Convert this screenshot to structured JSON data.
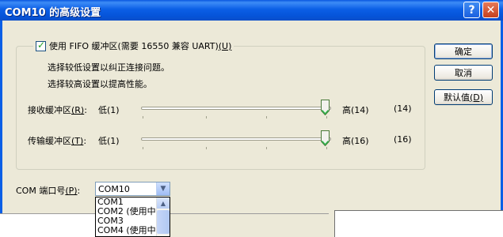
{
  "window": {
    "title": "COM10 的高级设置"
  },
  "titlebar_buttons": {
    "help": "?",
    "close": "✕"
  },
  "fifo": {
    "checkbox_label": "使用 FIFO 缓冲区(需要 16550 兼容 UART)",
    "checkbox_hotkey": "(U)",
    "checked": true,
    "hint_low": "选择较低设置以纠正连接问题。",
    "hint_high": "选择较高设置以提高性能。"
  },
  "receive": {
    "label": "接收缓冲区",
    "hotkey": "(R)",
    "suffix": ":",
    "low": "低(1)",
    "high": "高(14)",
    "value": "(14)",
    "level": 1.0
  },
  "transmit": {
    "label": "传输缓冲区",
    "hotkey": "(T)",
    "suffix": ":",
    "low": "低(1)",
    "high": "高(16)",
    "value": "(16)",
    "level": 1.0
  },
  "port": {
    "label": "COM 端口号",
    "hotkey": "(P)",
    "suffix": ":",
    "selected": "COM10",
    "options": [
      "COM1",
      "COM2 (使用中",
      "COM3",
      "COM4 (使用中"
    ]
  },
  "buttons": {
    "ok": "确定",
    "cancel": "取消",
    "defaults": "默认值",
    "defaults_hotkey": "(D)"
  }
}
